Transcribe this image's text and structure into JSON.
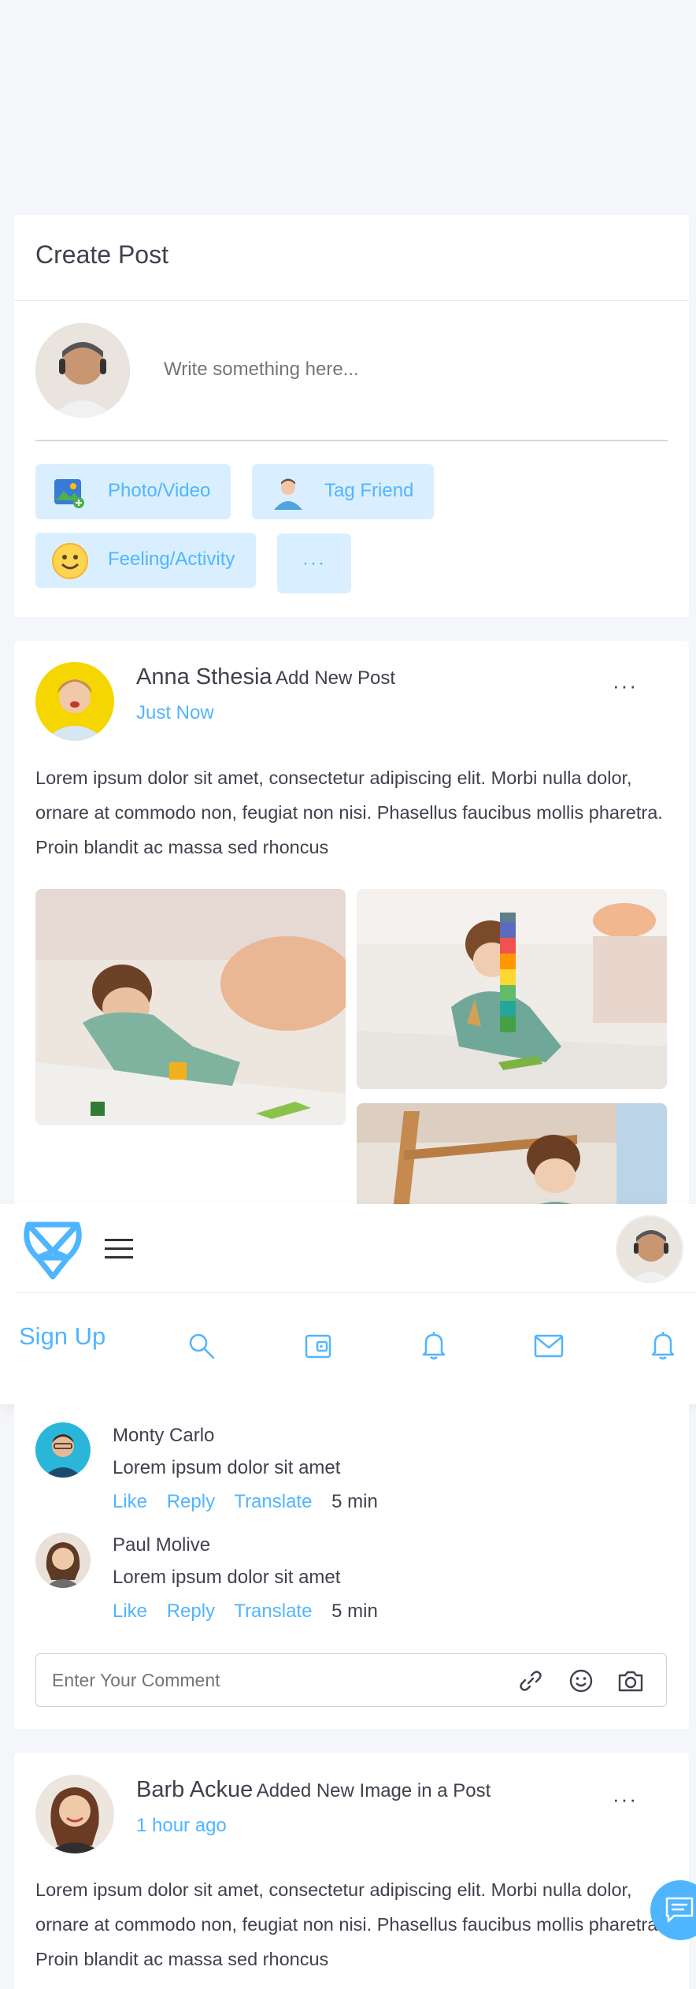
{
  "create_post": {
    "title": "Create Post",
    "placeholder": "Write something here...",
    "buttons": [
      {
        "label": "Photo/Video",
        "icon": "photo-icon"
      },
      {
        "label": "Tag Friend",
        "icon": "tag-friend-icon"
      },
      {
        "label": "Feeling/Activity",
        "icon": "smiley-icon"
      },
      {
        "label": "···",
        "icon": "more-dots-icon"
      }
    ]
  },
  "post1": {
    "author": "Anna Sthesia",
    "action": "Add New Post",
    "time": "Just Now",
    "more": "···",
    "body": "Lorem ipsum dolor sit amet, consectetur adipiscing elit. Morbi nulla dolor, ornare at commodo non, feugiat non nisi. Phasellus faucibus mollis pharetra. Proin blandit ac massa sed rhoncus"
  },
  "header": {
    "signup": "Sign Up",
    "icons": [
      "search-icon",
      "wallet-icon",
      "bell-icon",
      "mail-icon",
      "bell-icon"
    ]
  },
  "comments": [
    {
      "name": "Monty Carlo",
      "text": "Lorem ipsum dolor sit amet",
      "like": "Like",
      "reply": "Reply",
      "translate": "Translate",
      "time": "5 min"
    },
    {
      "name": "Paul Molive",
      "text": "Lorem ipsum dolor sit amet",
      "like": "Like",
      "reply": "Reply",
      "translate": "Translate",
      "time": "5 min"
    }
  ],
  "comment_input": {
    "placeholder": "Enter Your Comment"
  },
  "post2": {
    "author": "Barb Ackue",
    "action": "Added New Image in a Post",
    "time": "1 hour ago",
    "more": "···",
    "body": "Lorem ipsum dolor sit amet, consectetur adipiscing elit. Morbi nulla dolor, ornare at commodo non, feugiat non nisi. Phasellus faucibus mollis pharetra. Proin blandit ac massa sed rhoncus"
  },
  "colors": {
    "accent": "#50b5ff",
    "accent_bg": "#d9efff",
    "background": "#f5f6f9",
    "text": "#3f414d"
  }
}
